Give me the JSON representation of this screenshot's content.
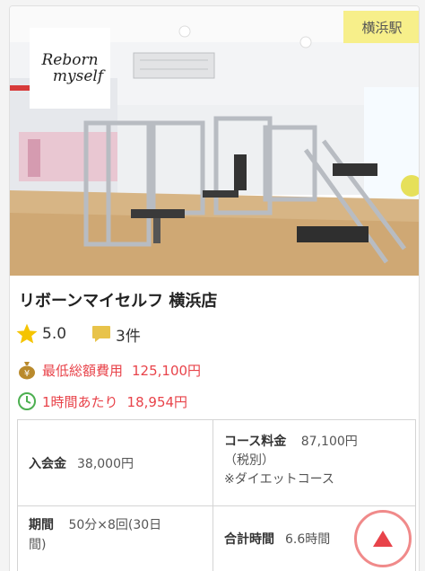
{
  "listing": {
    "station_badge": "横浜駅",
    "logo_line1": "Reborn",
    "logo_line2": "myself",
    "title": "リボーンマイセルフ 横浜店",
    "rating_value": "5.0",
    "review_count": "3件",
    "min_total_label": "最低総額費用",
    "min_total_value": "125,100円",
    "per_hour_label": "1時間あたり",
    "per_hour_value": "18,954円"
  },
  "details": {
    "enrollment_label": "入会金",
    "enrollment_value": "38,000円",
    "course_fee_label": "コース料金",
    "course_fee_value": "87,100円",
    "course_fee_tax": "（税別）",
    "course_name": "※ダイエットコース",
    "period_label": "期間",
    "period_value_1": "50分×8回(30日",
    "period_value_2": "間)",
    "total_time_label": "合計時間",
    "total_time_value": "6.6時間"
  },
  "colors": {
    "accent_red": "#e8434a",
    "badge_yellow": "#f7ef8a",
    "star": "#f5c400"
  },
  "icons": [
    "star-icon",
    "comment-icon",
    "yen-bag-icon",
    "clock-icon",
    "triangle-up-icon"
  ]
}
